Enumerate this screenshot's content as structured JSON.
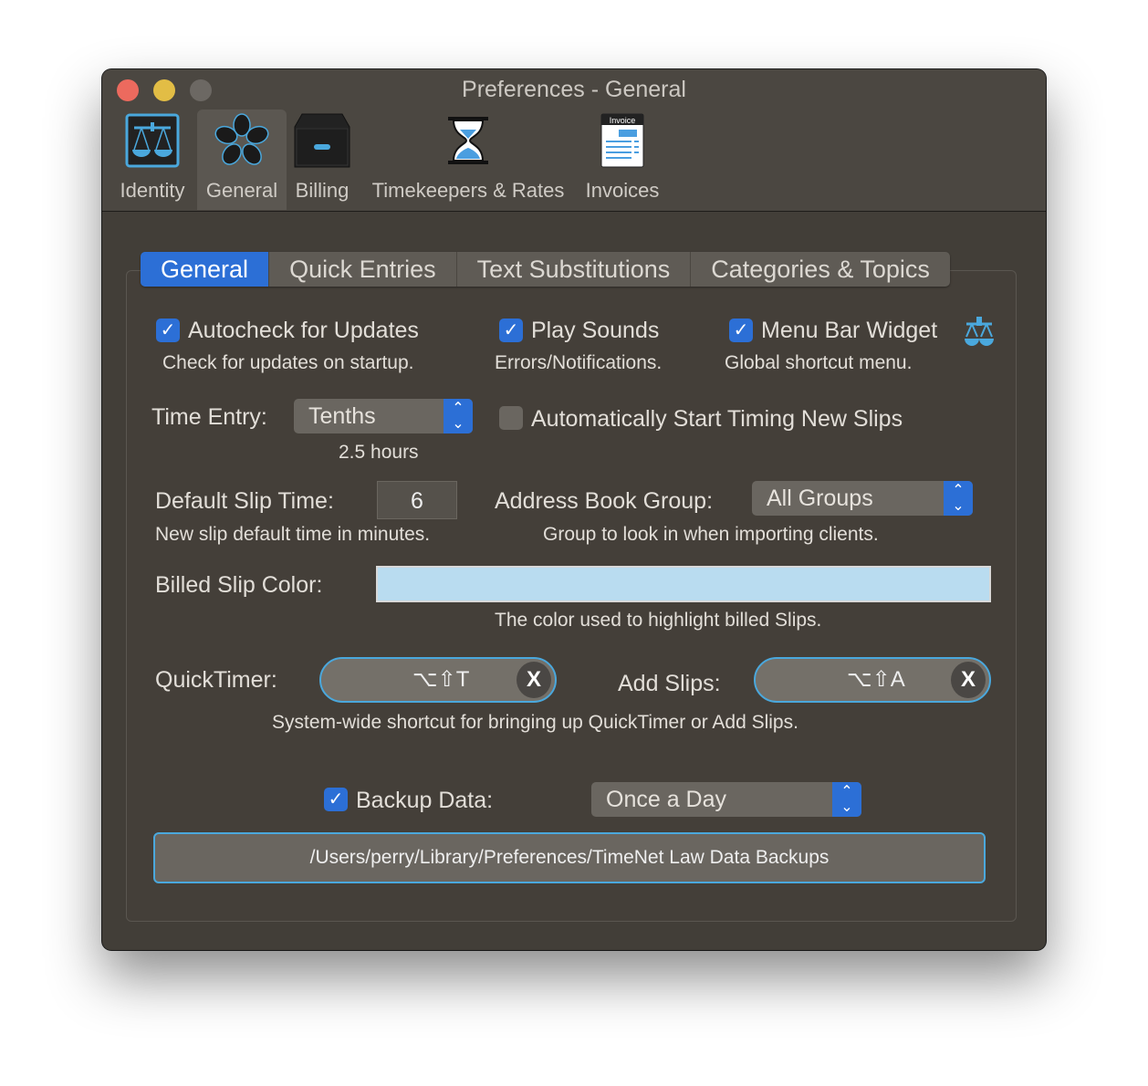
{
  "window": {
    "title": "Preferences - General"
  },
  "toolbar": [
    {
      "label": "Identity",
      "icon": "scales-icon"
    },
    {
      "label": "General",
      "icon": "flower-icon",
      "selected": true
    },
    {
      "label": "Billing",
      "icon": "file-cabinet-icon"
    },
    {
      "label": "Timekeepers & Rates",
      "icon": "hourglass-icon"
    },
    {
      "label": "Invoices",
      "icon": "invoice-icon",
      "icon_text": "Invoice"
    }
  ],
  "tabs": [
    {
      "label": "General",
      "selected": true
    },
    {
      "label": "Quick Entries"
    },
    {
      "label": "Text Substitutions"
    },
    {
      "label": "Categories & Topics"
    }
  ],
  "autocheck": {
    "label": "Autocheck for Updates",
    "desc": "Check for updates on startup.",
    "checked": true
  },
  "play_sounds": {
    "label": "Play Sounds",
    "desc": "Errors/Notifications.",
    "checked": true
  },
  "menu_bar": {
    "label": "Menu Bar Widget",
    "desc": "Global shortcut menu.",
    "checked": true
  },
  "time_entry": {
    "label": "Time Entry:",
    "value": "Tenths",
    "example": "2.5 hours"
  },
  "auto_start": {
    "label": "Automatically Start Timing New Slips",
    "checked": false
  },
  "default_slip": {
    "label": "Default Slip Time:",
    "value": "6",
    "desc": "New slip default time in minutes."
  },
  "address_group": {
    "label": "Address Book Group:",
    "value": "All Groups",
    "desc": "Group to look in when importing clients."
  },
  "billed_color": {
    "label": "Billed Slip Color:",
    "color": "#b9dcf0",
    "desc": "The color used to highlight billed Slips."
  },
  "quicktimer": {
    "label": "QuickTimer:",
    "shortcut": "⌥⇧T",
    "clear": "X"
  },
  "add_slips": {
    "label": "Add Slips:",
    "shortcut": "⌥⇧A",
    "clear": "X"
  },
  "shortcut_desc": "System-wide shortcut for bringing up QuickTimer or Add Slips.",
  "backup": {
    "label": "Backup Data:",
    "checked": true,
    "frequency": "Once a Day",
    "path": "/Users/perry/Library/Preferences/TimeNet Law Data Backups"
  },
  "colors": {
    "accent": "#2c6fd6",
    "focus": "#4aa8dd"
  }
}
